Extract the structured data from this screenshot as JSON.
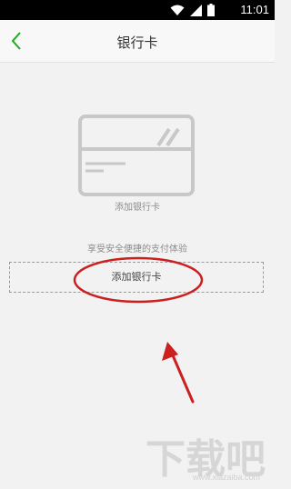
{
  "status_bar": {
    "time": "11:01",
    "icons": [
      "wifi-icon",
      "cell-signal-icon",
      "battery-icon"
    ]
  },
  "nav": {
    "back_icon": "chevron-left-icon",
    "title": "银行卡"
  },
  "empty_state": {
    "illustration": "bank-card-icon",
    "title": "添加银行卡",
    "subtitle": "享受安全便捷的支付体验"
  },
  "add_button": {
    "label": "添加银行卡"
  },
  "annotation": {
    "circle_color": "#cc1f1f",
    "arrow_color": "#cc1f1f"
  },
  "watermark": {
    "text": "下载吧",
    "url": "www.xiazaiba.com"
  },
  "colors": {
    "accent": "#1aad19",
    "background": "#f2f2f2",
    "card_outline": "#c8c8c8"
  }
}
